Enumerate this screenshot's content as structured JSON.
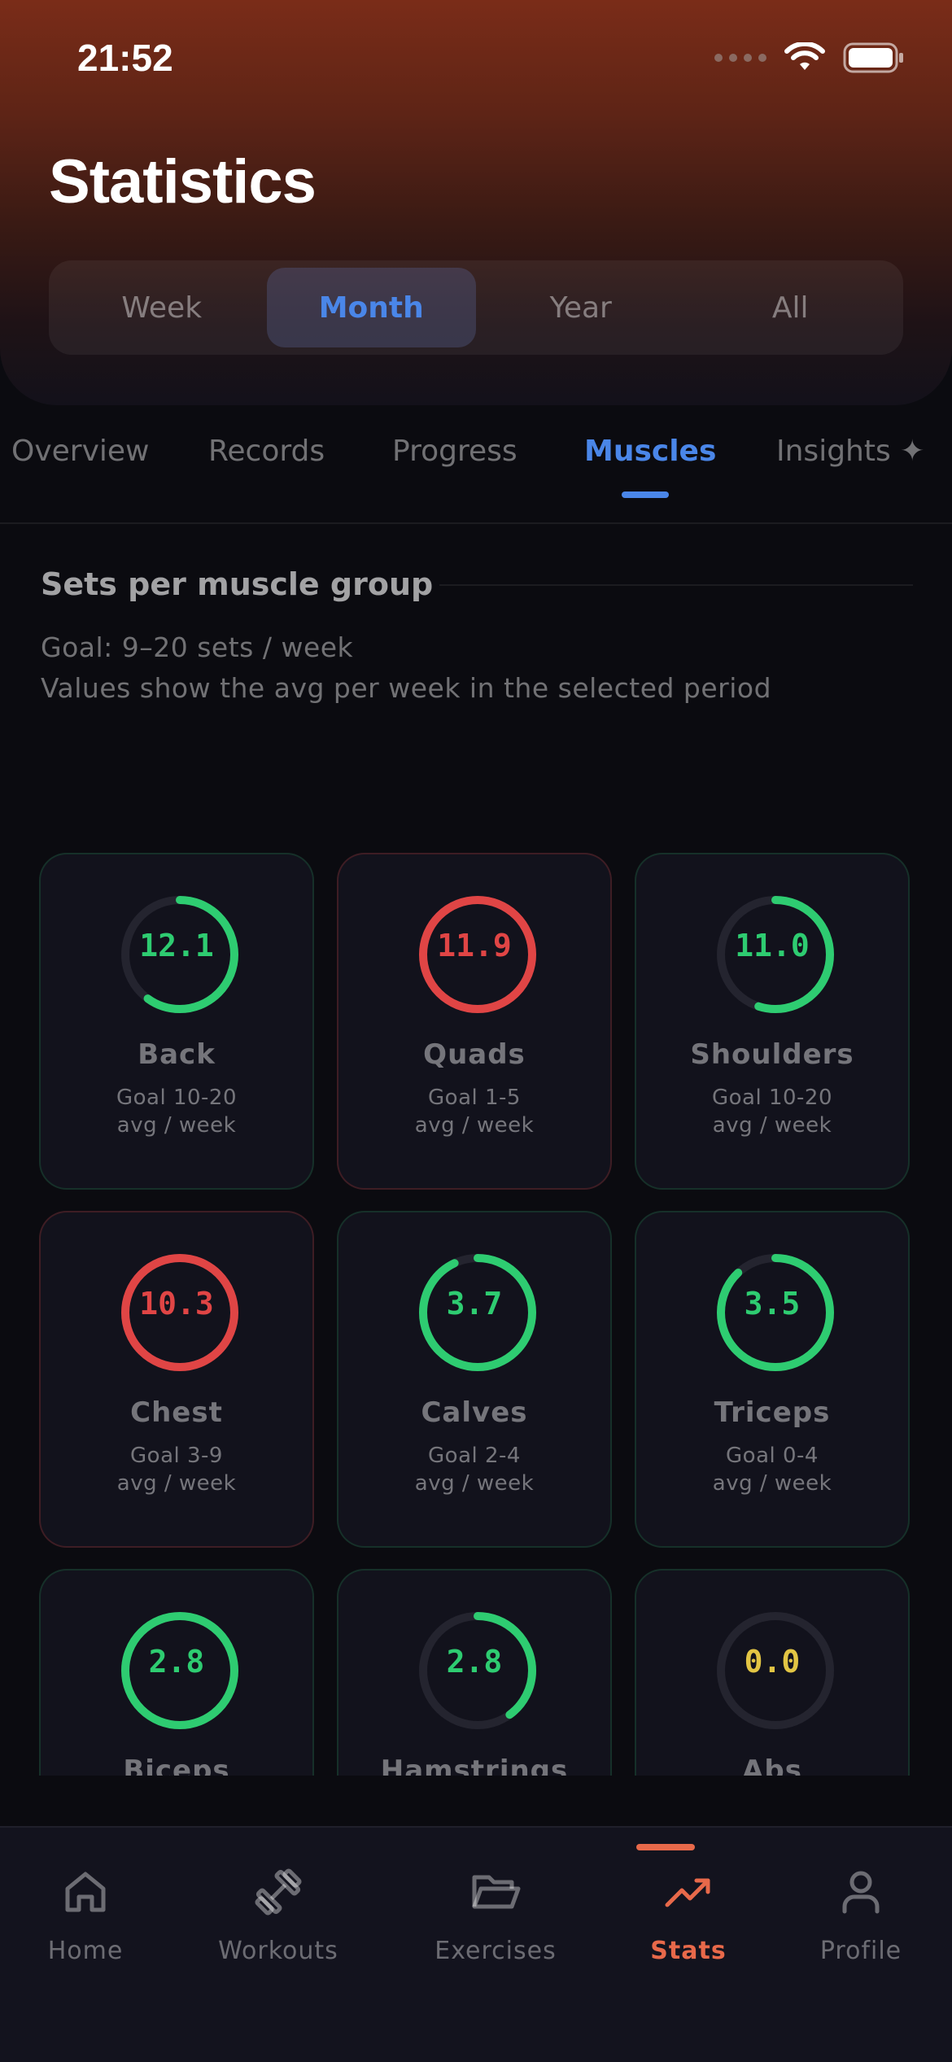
{
  "status_bar": {
    "time": "21:52"
  },
  "header": {
    "title": "Statistics"
  },
  "period_segments": [
    {
      "label": "Week",
      "active": false
    },
    {
      "label": "Month",
      "active": true
    },
    {
      "label": "Year",
      "active": false
    },
    {
      "label": "All",
      "active": false
    }
  ],
  "tabs": [
    {
      "label": "Overview",
      "active": false
    },
    {
      "label": "Records",
      "active": false
    },
    {
      "label": "Progress",
      "active": false
    },
    {
      "label": "Muscles",
      "active": true
    },
    {
      "label": "Insights ✦",
      "active": false
    }
  ],
  "section": {
    "title": "Sets per muscle group",
    "goal": "Goal: 9–20 sets / week",
    "subtitle": "Values show the avg per week in the selected period"
  },
  "colors": {
    "green": "#2ecc71",
    "red": "#e04545",
    "yellow": "#e2c544",
    "accent_blue": "#4a86e8",
    "accent_orange": "#e8694a",
    "track": "#24242f"
  },
  "muscles": [
    {
      "name": "Back",
      "value": "12.1",
      "goal": "Goal 10-20",
      "unit": "avg / week",
      "fraction": 0.6,
      "status": "green"
    },
    {
      "name": "Quads",
      "value": "11.9",
      "goal": "Goal 1-5",
      "unit": "avg / week",
      "fraction": 1.0,
      "status": "red"
    },
    {
      "name": "Shoulders",
      "value": "11.0",
      "goal": "Goal 10-20",
      "unit": "avg / week",
      "fraction": 0.55,
      "status": "green"
    },
    {
      "name": "Chest",
      "value": "10.3",
      "goal": "Goal 3-9",
      "unit": "avg / week",
      "fraction": 1.0,
      "status": "red"
    },
    {
      "name": "Calves",
      "value": "3.7",
      "goal": "Goal 2-4",
      "unit": "avg / week",
      "fraction": 0.93,
      "status": "green"
    },
    {
      "name": "Triceps",
      "value": "3.5",
      "goal": "Goal 0-4",
      "unit": "avg / week",
      "fraction": 0.88,
      "status": "green"
    },
    {
      "name": "Biceps",
      "value": "2.8",
      "goal": "",
      "unit": "",
      "fraction": 1.0,
      "status": "green"
    },
    {
      "name": "Hamstrings",
      "value": "2.8",
      "goal": "",
      "unit": "",
      "fraction": 0.4,
      "status": "green"
    },
    {
      "name": "Abs",
      "value": "0.0",
      "goal": "",
      "unit": "",
      "fraction": 0.0,
      "status": "yellow"
    }
  ],
  "nav": [
    {
      "label": "Home",
      "icon": "home-icon",
      "active": false
    },
    {
      "label": "Workouts",
      "icon": "dumbbell-icon",
      "active": false
    },
    {
      "label": "Exercises",
      "icon": "folder-icon",
      "active": false
    },
    {
      "label": "Stats",
      "icon": "trending-up-icon",
      "active": true
    },
    {
      "label": "Profile",
      "icon": "person-icon",
      "active": false
    }
  ]
}
